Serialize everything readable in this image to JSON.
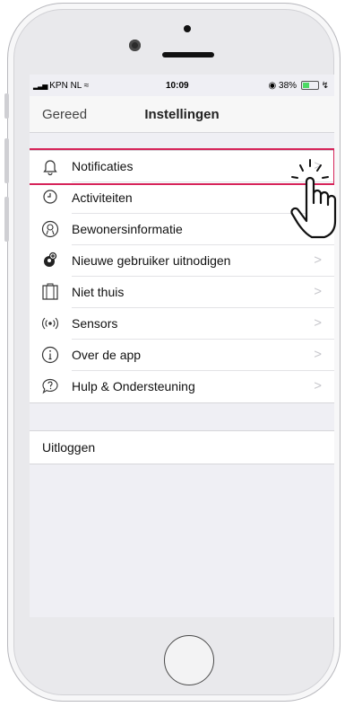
{
  "status_bar": {
    "carrier": "KPN NL",
    "time": "10:09",
    "battery": "38%"
  },
  "nav": {
    "back_label": "Gereed",
    "title": "Instellingen"
  },
  "settings_items": [
    {
      "label": "Notificaties",
      "icon": "bell-icon"
    },
    {
      "label": "Activiteiten",
      "icon": "clock-icon"
    },
    {
      "label": "Bewonersinformatie",
      "icon": "residents-icon"
    },
    {
      "label": "Nieuwe gebruiker uitnodigen",
      "icon": "invite-user-icon"
    },
    {
      "label": "Niet thuis",
      "icon": "not-home-icon"
    },
    {
      "label": "Sensors",
      "icon": "sensor-signal-icon"
    },
    {
      "label": "Over de app",
      "icon": "info-icon"
    },
    {
      "label": "Hulp & Ondersteuning",
      "icon": "help-bubble-icon"
    }
  ],
  "chevron": ">",
  "logout_label": "Uitloggen",
  "colors": {
    "highlight": "#d6245a",
    "group_bg": "#efeff4",
    "battery": "#4cd964"
  }
}
